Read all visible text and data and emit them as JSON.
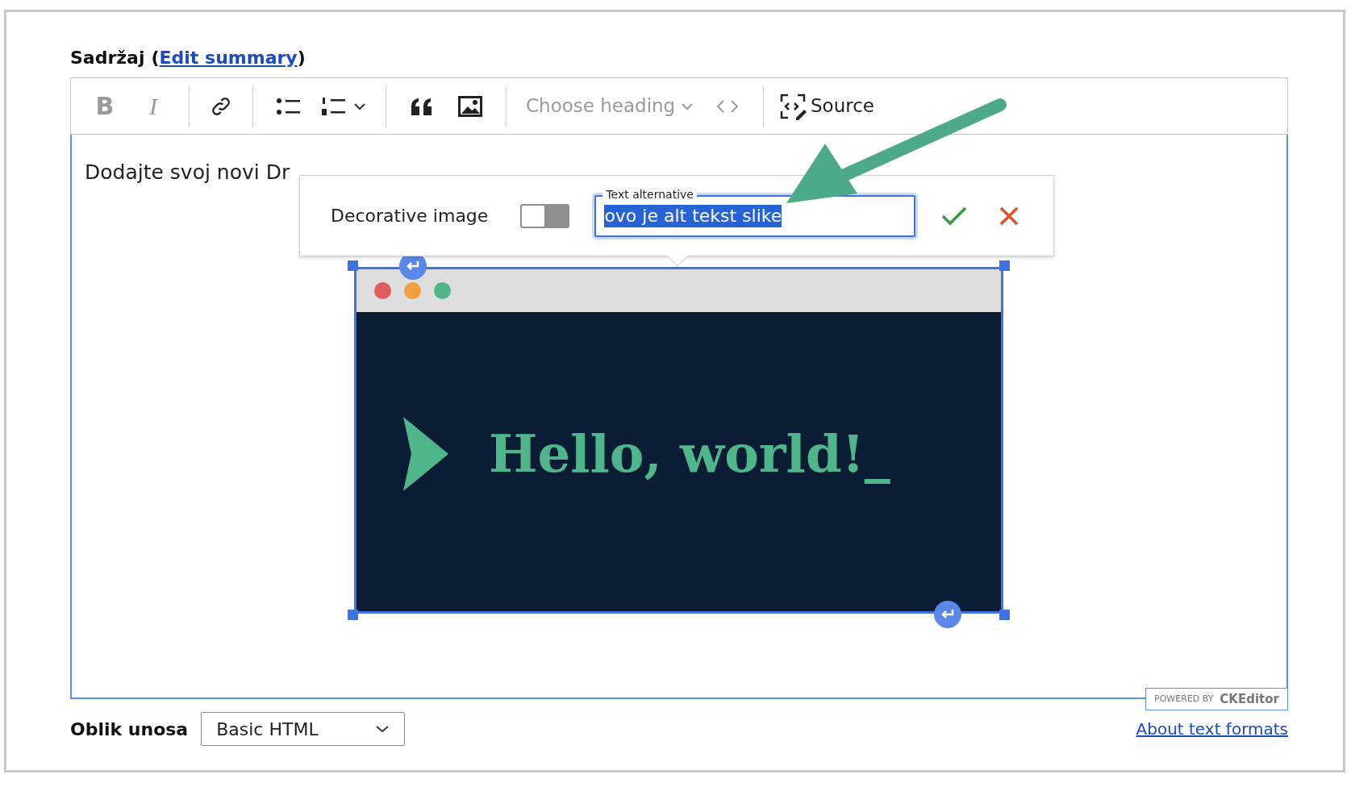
{
  "field_label": {
    "text": "Sadržaj",
    "paren_open": "(",
    "link": "Edit summary",
    "paren_close": ")"
  },
  "toolbar": [
    {
      "kind": "bold",
      "label": "B",
      "disabled": true
    },
    {
      "kind": "italic",
      "label": "I",
      "disabled": true
    },
    {
      "kind": "sep"
    },
    {
      "kind": "link"
    },
    {
      "kind": "sep"
    },
    {
      "kind": "bullets"
    },
    {
      "kind": "numbered"
    },
    {
      "kind": "sep"
    },
    {
      "kind": "quote"
    },
    {
      "kind": "image"
    },
    {
      "kind": "sep"
    },
    {
      "kind": "heading",
      "label": "Choose heading",
      "disabled": true
    },
    {
      "kind": "code",
      "disabled": true
    },
    {
      "kind": "sep"
    },
    {
      "kind": "source",
      "label": "Source"
    }
  ],
  "content": {
    "paragraph": "Dodajte svoj novi Dr",
    "image_text": "Hello, world!_"
  },
  "popup": {
    "toggle_label": "Decorative image",
    "decorative": false,
    "field_label": "Text alternative",
    "value": "ovo je alt tekst slike",
    "value_selected": true
  },
  "badge": {
    "prefix": "POWERED BY",
    "brand": "CKEditor"
  },
  "format": {
    "label": "Oblik unosa",
    "value": "Basic HTML",
    "link": "About text formats"
  }
}
